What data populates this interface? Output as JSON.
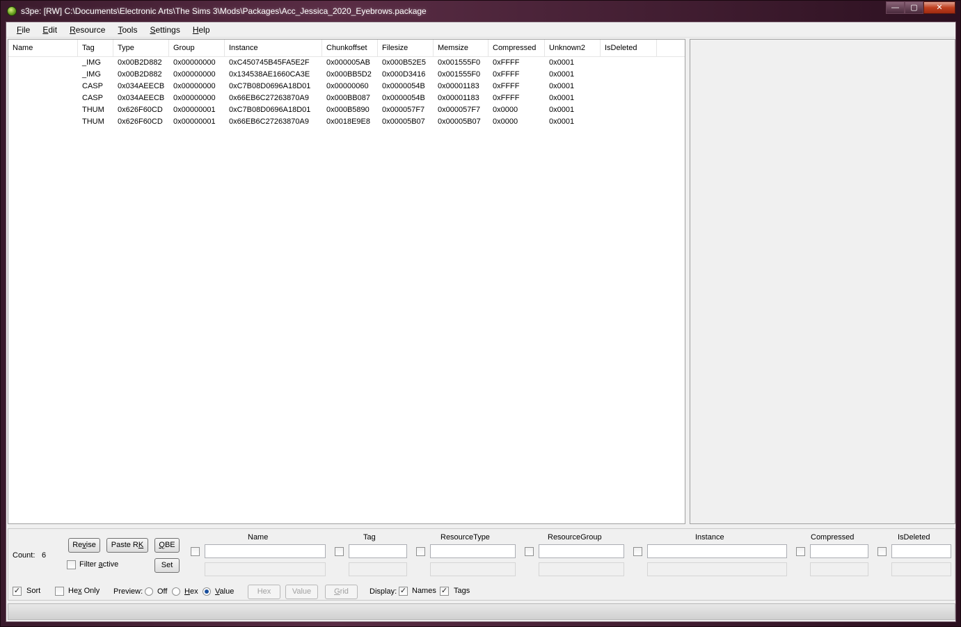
{
  "window": {
    "title": "s3pe: [RW] C:\\Documents\\Electronic Arts\\The Sims 3\\Mods\\Packages\\Acc_Jessica_2020_Eyebrows.package",
    "minimize": "—",
    "maximize": "▢",
    "close": "✕"
  },
  "menu": {
    "items": [
      {
        "hot": "F",
        "rest": "ile"
      },
      {
        "hot": "E",
        "rest": "dit"
      },
      {
        "hot": "R",
        "rest": "esource"
      },
      {
        "hot": "T",
        "rest": "ools"
      },
      {
        "hot": "S",
        "rest": "ettings"
      },
      {
        "hot": "H",
        "rest": "elp"
      }
    ]
  },
  "list": {
    "columns": [
      "Name",
      "Tag",
      "Type",
      "Group",
      "Instance",
      "Chunkoffset",
      "Filesize",
      "Memsize",
      "Compressed",
      "Unknown2",
      "IsDeleted"
    ],
    "rows": [
      [
        "",
        "_IMG",
        "0x00B2D882",
        "0x00000000",
        "0xC450745B45FA5E2F",
        "0x000005AB",
        "0x000B52E5",
        "0x001555F0",
        "0xFFFF",
        "0x0001",
        ""
      ],
      [
        "",
        "_IMG",
        "0x00B2D882",
        "0x00000000",
        "0x134538AE1660CA3E",
        "0x000BB5D2",
        "0x000D3416",
        "0x001555F0",
        "0xFFFF",
        "0x0001",
        ""
      ],
      [
        "",
        "CASP",
        "0x034AEECB",
        "0x00000000",
        "0xC7B08D0696A18D01",
        "0x00000060",
        "0x0000054B",
        "0x00001183",
        "0xFFFF",
        "0x0001",
        ""
      ],
      [
        "",
        "CASP",
        "0x034AEECB",
        "0x00000000",
        "0x66EB6C27263870A9",
        "0x000BB087",
        "0x0000054B",
        "0x00001183",
        "0xFFFF",
        "0x0001",
        ""
      ],
      [
        "",
        "THUM",
        "0x626F60CD",
        "0x00000001",
        "0xC7B08D0696A18D01",
        "0x000B5890",
        "0x000057F7",
        "0x000057F7",
        "0x0000",
        "0x0001",
        ""
      ],
      [
        "",
        "THUM",
        "0x626F60CD",
        "0x00000001",
        "0x66EB6C27263870A9",
        "0x0018E9E8",
        "0x00005B07",
        "0x00005B07",
        "0x0000",
        "0x0001",
        ""
      ]
    ]
  },
  "filter": {
    "count_label": "Count:",
    "count_value": "6",
    "revise": {
      "hot": "v",
      "pre": "Re",
      "post": "ise"
    },
    "paste_rk": {
      "pre": "Paste R",
      "hot": "K",
      "post": ""
    },
    "qbe": {
      "pre": "",
      "hot": "Q",
      "post": "BE"
    },
    "set_label": "Set",
    "filter_active": {
      "pre": "Filter ",
      "hot": "a",
      "post": "ctive"
    },
    "fields": {
      "name": "Name",
      "tag": "Tag",
      "resource_type": "ResourceType",
      "resource_group": "ResourceGroup",
      "instance": "Instance",
      "compressed": "Compressed",
      "is_deleted": "IsDeleted"
    }
  },
  "options": {
    "sort_label": "Sort",
    "sort_checked": true,
    "hex_only": {
      "pre": "He",
      "hot": "x",
      "post": " Only"
    },
    "hex_only_checked": false,
    "preview_label": "Preview:",
    "preview_off": "Off",
    "preview_hex": {
      "hot": "H",
      "post": "ex"
    },
    "preview_value": {
      "hot": "V",
      "post": "alue"
    },
    "preview_selected": "Value",
    "hex_button": "Hex",
    "value_button": "Value",
    "grid_button": {
      "hot": "G",
      "post": "rid"
    },
    "display_label": "Display:",
    "names_label": "Names",
    "names_checked": true,
    "tags_label": "Tags",
    "tags_checked": true
  }
}
